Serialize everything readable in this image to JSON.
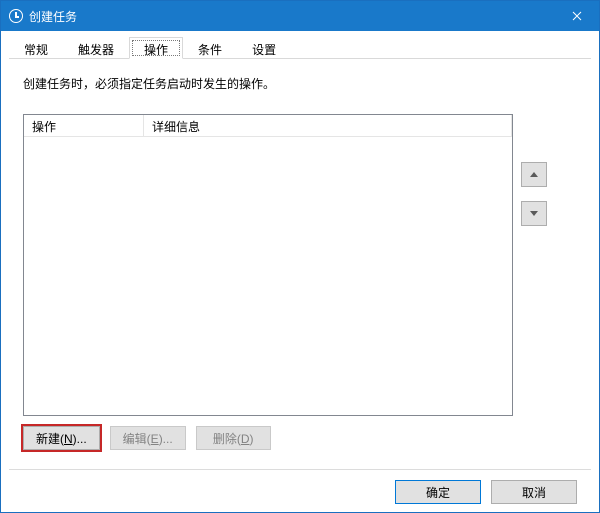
{
  "window": {
    "title": "创建任务"
  },
  "tabs": [
    {
      "label": "常规"
    },
    {
      "label": "触发器"
    },
    {
      "label": "操作",
      "active": true
    },
    {
      "label": "条件"
    },
    {
      "label": "设置"
    }
  ],
  "tabpage": {
    "instruction": "创建任务时，必须指定任务启动时发生的操作。",
    "columns": {
      "operation": "操作",
      "details": "详细信息"
    },
    "buttons": {
      "new_prefix": "新建(",
      "new_key": "N",
      "new_suffix": ")...",
      "edit_prefix": "编辑(",
      "edit_key": "E",
      "edit_suffix": ")...",
      "delete_prefix": "删除(",
      "delete_key": "D",
      "delete_suffix": ")"
    }
  },
  "footer": {
    "ok": "确定",
    "cancel": "取消"
  }
}
